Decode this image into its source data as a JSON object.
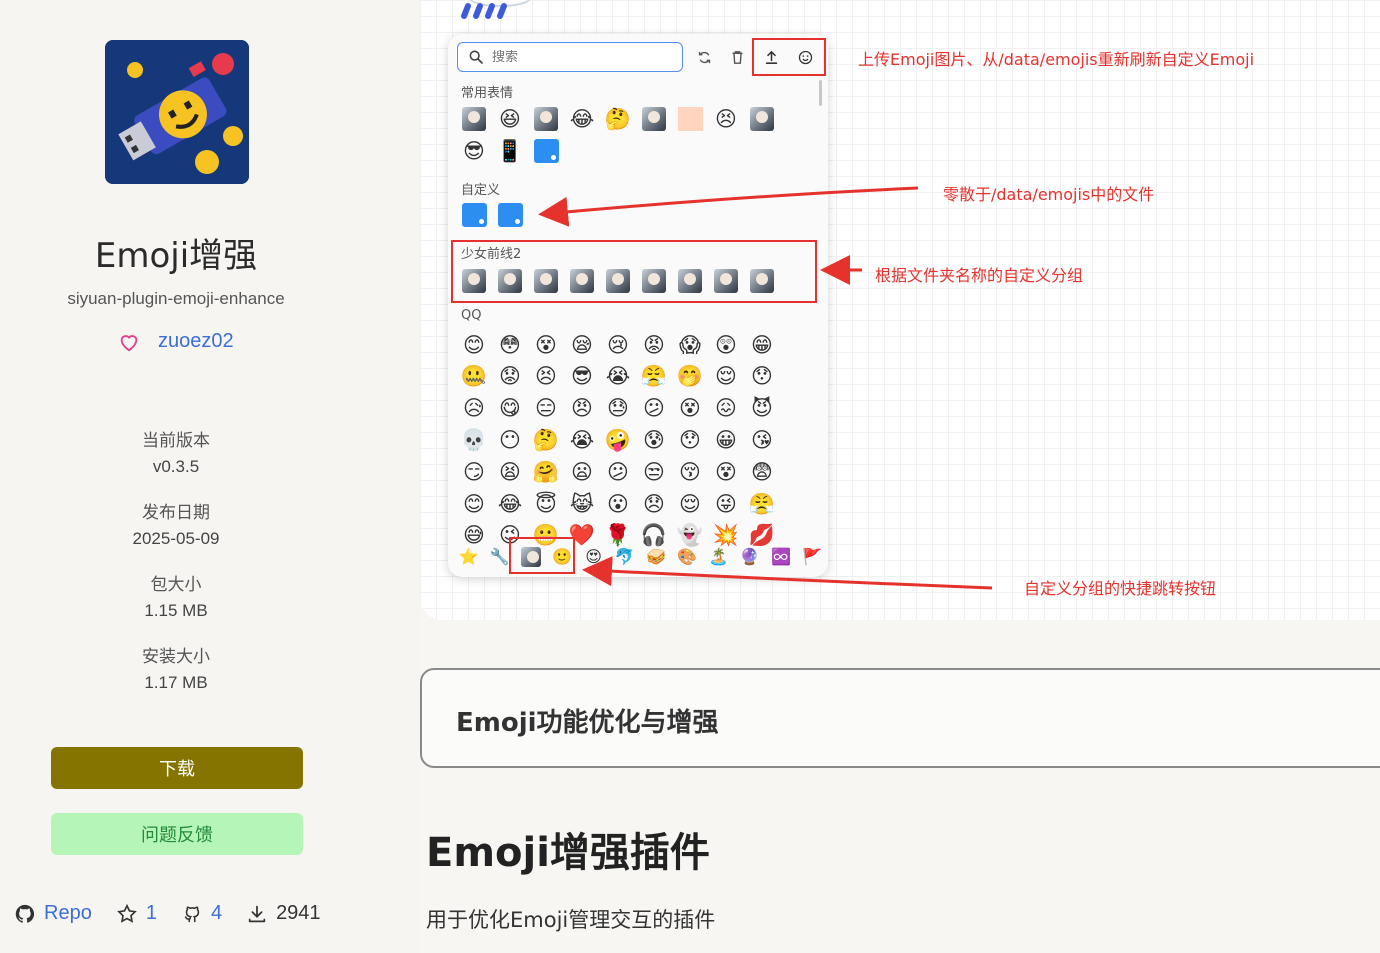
{
  "plugin": {
    "title": "Emoji增强",
    "id": "siyuan-plugin-emoji-enhance",
    "author": "zuoez02",
    "version_label": "当前版本",
    "version": "v0.3.5",
    "release_label": "发布日期",
    "release_date": "2025-05-09",
    "package_size_label": "包大小",
    "package_size": "1.15 MB",
    "install_size_label": "安装大小",
    "install_size": "1.17 MB",
    "download_label": "下载",
    "feedback_label": "问题反馈",
    "repo_label": "Repo",
    "stars": "1",
    "forks": "4",
    "downloads": "2941"
  },
  "picker": {
    "search_placeholder": "搜索",
    "sections": {
      "frequent": "常用表情",
      "custom": "自定义",
      "group": "少女前线2",
      "qq": "QQ"
    },
    "frequent_emojis": [
      "avatar",
      "😆",
      "avatar",
      "😂",
      "🤔",
      "avatar",
      "peach",
      "😣",
      "avatar",
      "😎",
      "📱",
      "blue"
    ],
    "group_emojis": [
      "avatar",
      "avatar",
      "avatar",
      "avatar",
      "avatar",
      "avatar",
      "avatar",
      "avatar",
      "avatar"
    ],
    "qq_rows": [
      [
        "😊",
        "😳",
        "😵",
        "😪",
        "😢",
        "😡",
        "😱",
        "😲",
        "😁"
      ],
      [
        "🤐",
        "😟",
        "😣",
        "😎",
        "😭",
        "😤",
        "🤭",
        "😌",
        "😯"
      ],
      [
        "😥",
        "😋",
        "😑",
        "😠",
        "😓",
        "😕",
        "😵",
        "😖",
        "😈"
      ],
      [
        "💀",
        "😶",
        "🤔",
        "😭",
        "🤪",
        "😰",
        "😯",
        "😀",
        "😘"
      ],
      [
        "😏",
        "😫",
        "🤗",
        "😦",
        "😕",
        "😒",
        "😚",
        "😵",
        "😨"
      ],
      [
        "😊",
        "😂",
        "😇",
        "😹",
        "😮",
        "😞",
        "😌",
        "😜",
        "😤"
      ],
      [
        "😅",
        "😉",
        "😬",
        "❤️",
        "🌹",
        "🎧",
        "👻",
        "💥",
        "💋"
      ]
    ],
    "bottom_tabs": [
      "⭐",
      "🔧",
      "avatar",
      "🙂",
      "😍",
      "🐬",
      "🥪",
      "🎨",
      "🏝️",
      "🔮",
      "♾️",
      "🚩"
    ]
  },
  "annotations": {
    "top": "上传Emoji图片、从/data/emojis重新刷新自定义Emoji",
    "custom": "零散于/data/emojis中的文件",
    "group": "根据文件夹名称的自定义分组",
    "shortcut": "自定义分组的快捷跳转按钮"
  },
  "readme": {
    "card_title": "Emoji功能优化与增强",
    "heading": "Emoji增强插件",
    "intro": "用于优化Emoji管理交互的插件"
  },
  "colors": {
    "accent_link": "#3b6fd6",
    "download_btn": "#857500",
    "feedback_btn": "#b6f5b8",
    "annotation_red": "#e5322d"
  }
}
